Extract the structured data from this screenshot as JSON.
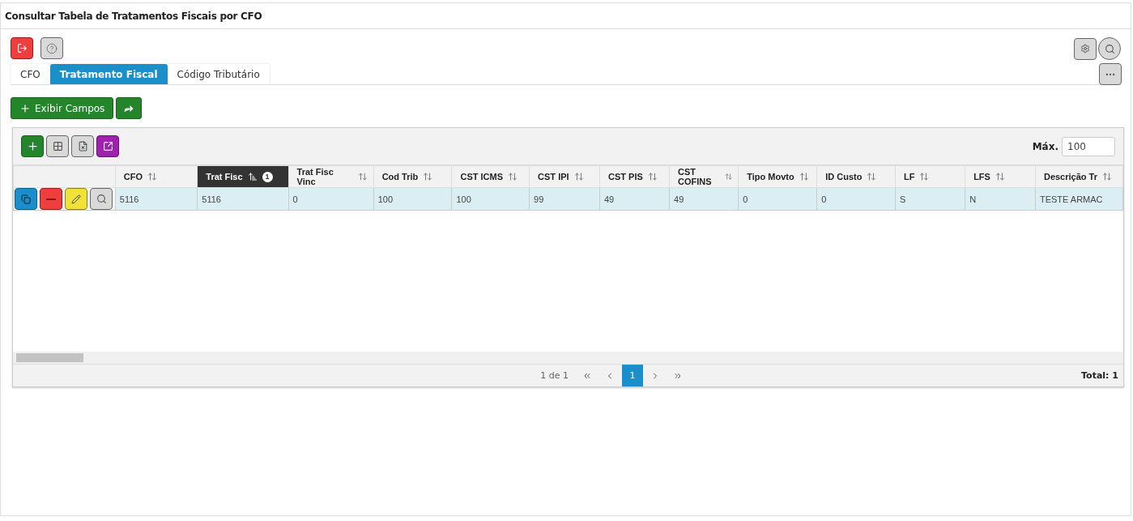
{
  "window": {
    "title": "Consultar Tabela de Tratamentos Fiscais por CFO"
  },
  "tabs": [
    {
      "label": "CFO",
      "selected": false
    },
    {
      "label": "Tratamento Fiscal",
      "selected": true
    },
    {
      "label": "Código Tributário",
      "selected": false
    }
  ],
  "actions": {
    "show_fields": "Exibir Campos"
  },
  "grid": {
    "max_label": "Máx.",
    "max_value": "100",
    "columns": [
      {
        "label": "CFO",
        "sorted": false
      },
      {
        "label": "Trat Fisc",
        "sorted": true,
        "sort_order": "1"
      },
      {
        "label": "Trat Fisc Vinc",
        "sorted": false
      },
      {
        "label": "Cod Trib",
        "sorted": false
      },
      {
        "label": "CST ICMS",
        "sorted": false
      },
      {
        "label": "CST IPI",
        "sorted": false
      },
      {
        "label": "CST PIS",
        "sorted": false
      },
      {
        "label": "CST COFINS",
        "sorted": false
      },
      {
        "label": "Tipo Movto",
        "sorted": false
      },
      {
        "label": "ID Custo",
        "sorted": false
      },
      {
        "label": "LF",
        "sorted": false
      },
      {
        "label": "LFS",
        "sorted": false
      },
      {
        "label": "Descrição Tr",
        "sorted": false
      }
    ],
    "rows": [
      {
        "selected": true,
        "cells": [
          "5116",
          "5116",
          "0",
          "100",
          "100",
          "99",
          "49",
          "49",
          "0",
          "0",
          "S",
          "N",
          "TESTE ARMAC"
        ]
      }
    ]
  },
  "pagination": {
    "summary": "1 de 1",
    "pages": [
      {
        "label": "1",
        "selected": true
      }
    ],
    "total": "Total: 1"
  }
}
